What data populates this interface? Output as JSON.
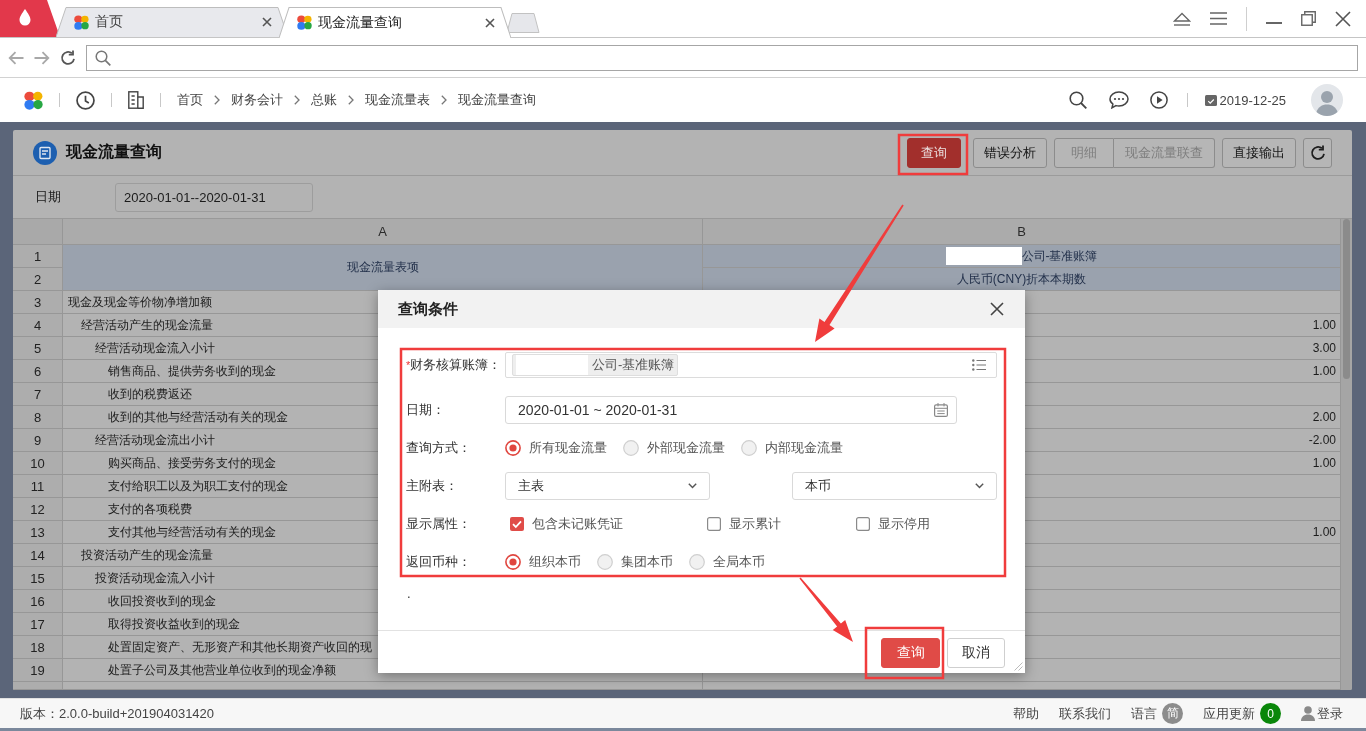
{
  "browser": {
    "tabs": [
      {
        "title": "首页",
        "selected": false
      },
      {
        "title": "现金流量查询",
        "selected": true
      }
    ]
  },
  "app_bar": {
    "breadcrumb": [
      "首页",
      "财务会计",
      "总账",
      "现金流量表",
      "现金流量查询"
    ],
    "date": "2019-12-25"
  },
  "page": {
    "title": "现金流量查询",
    "toolbar": [
      {
        "kind": "primary",
        "label": "查询",
        "disabled": false
      },
      {
        "kind": "default",
        "label": "错误分析",
        "disabled": false
      },
      {
        "kind": "grouped",
        "label": "明细",
        "disabled": true
      },
      {
        "kind": "grouped",
        "label": "现金流量联查",
        "disabled": true
      },
      {
        "kind": "default",
        "label": "直接输出",
        "disabled": false
      },
      {
        "kind": "refresh",
        "disabled": false
      }
    ],
    "filter": {
      "label": "日期",
      "value": "2020-01-01--2020-01-31"
    }
  },
  "sheet": {
    "columns": [
      "A",
      "B"
    ],
    "header_rows": [
      "1",
      "2"
    ],
    "item_header": "现金流量表项",
    "book_header": "公司-基准账簿",
    "amount_header": "人民币(CNY)折本本期数",
    "rows": [
      {
        "number": "3",
        "item": "现金及现金等价物净增加额",
        "children": [
          {
            "number": "4",
            "item": "经营活动产生的现金流量",
            "amount": "1.00",
            "children": [
              {
                "number": "5",
                "item": "经营活动现金流入小计",
                "amount": "3.00",
                "children": [
                  {
                    "number": "6",
                    "item": "销售商品、提供劳务收到的现金",
                    "amount": "1.00"
                  },
                  {
                    "number": "7",
                    "item": "收到的税费返还"
                  },
                  {
                    "number": "8",
                    "item": "收到的其他与经营活动有关的现金",
                    "amount": "2.00"
                  }
                ]
              },
              {
                "number": "9",
                "item": "经营活动现金流出小计",
                "amount": "-2.00",
                "children": [
                  {
                    "number": "10",
                    "item": "购买商品、接受劳务支付的现金",
                    "amount": "1.00"
                  },
                  {
                    "number": "11",
                    "item": "支付给职工以及为职工支付的现金"
                  },
                  {
                    "number": "12",
                    "item": "支付的各项税费"
                  },
                  {
                    "number": "13",
                    "item": "支付其他与经营活动有关的现金",
                    "amount": "1.00"
                  }
                ]
              }
            ]
          },
          {
            "number": "14",
            "item": "投资活动产生的现金流量",
            "children": [
              {
                "number": "15",
                "item": "投资活动现金流入小计",
                "children": [
                  {
                    "number": "16",
                    "item": "收回投资收到的现金"
                  },
                  {
                    "number": "17",
                    "item": "取得投资收益收到的现金"
                  },
                  {
                    "number": "18",
                    "item": "处置固定资产、无形资产和其他长期资产收回的现"
                  },
                  {
                    "number": "19",
                    "item": "处置子公司及其他营业单位收到的现金净额"
                  }
                ]
              }
            ]
          }
        ]
      }
    ]
  },
  "dialog": {
    "title": "查询条件",
    "fields": [
      {
        "kind": "tags",
        "required_mark": "*",
        "label": "财务核算账簿：",
        "tags": [
          "公司-基准账簿"
        ]
      },
      {
        "kind": "date",
        "label": "日期：",
        "value": "2020-01-01 ~ 2020-01-31"
      },
      {
        "kind": "radios",
        "label": "查询方式：",
        "options": [
          {
            "label": "所有现金流量",
            "selected": true
          },
          {
            "label": "外部现金流量",
            "selected": false
          },
          {
            "label": "内部现金流量",
            "selected": false
          }
        ]
      },
      {
        "kind": "selects",
        "label": "主附表：",
        "selects": [
          "主表",
          "本币"
        ]
      },
      {
        "kind": "checkboxes",
        "label": "显示属性：",
        "options": [
          {
            "label": "包含未记账凭证",
            "checked": true
          },
          {
            "label": "显示累计",
            "checked": false
          },
          {
            "label": "显示停用",
            "checked": false
          }
        ]
      },
      {
        "kind": "radios",
        "label": "返回币种：",
        "options": [
          {
            "label": "组织本币",
            "selected": true
          },
          {
            "label": "集团本币",
            "selected": false
          },
          {
            "label": "全局本币",
            "selected": false
          }
        ]
      }
    ],
    "note": ".",
    "buttons": [
      {
        "kind": "primary",
        "label": "查询"
      },
      {
        "kind": "default",
        "label": "取消"
      }
    ]
  },
  "status_bar": {
    "version": "版本：2.0.0-build+201904031420",
    "links": [
      {
        "kind": "plain",
        "label": "帮助"
      },
      {
        "kind": "plain",
        "label": "联系我们"
      },
      {
        "kind": "badge",
        "label": "语言",
        "badge": "简",
        "color": "#8c8c8c"
      },
      {
        "kind": "badge",
        "label": "应用更新",
        "badge": "0",
        "color": "#0a870a"
      },
      {
        "kind": "user",
        "label": "登录"
      }
    ]
  }
}
